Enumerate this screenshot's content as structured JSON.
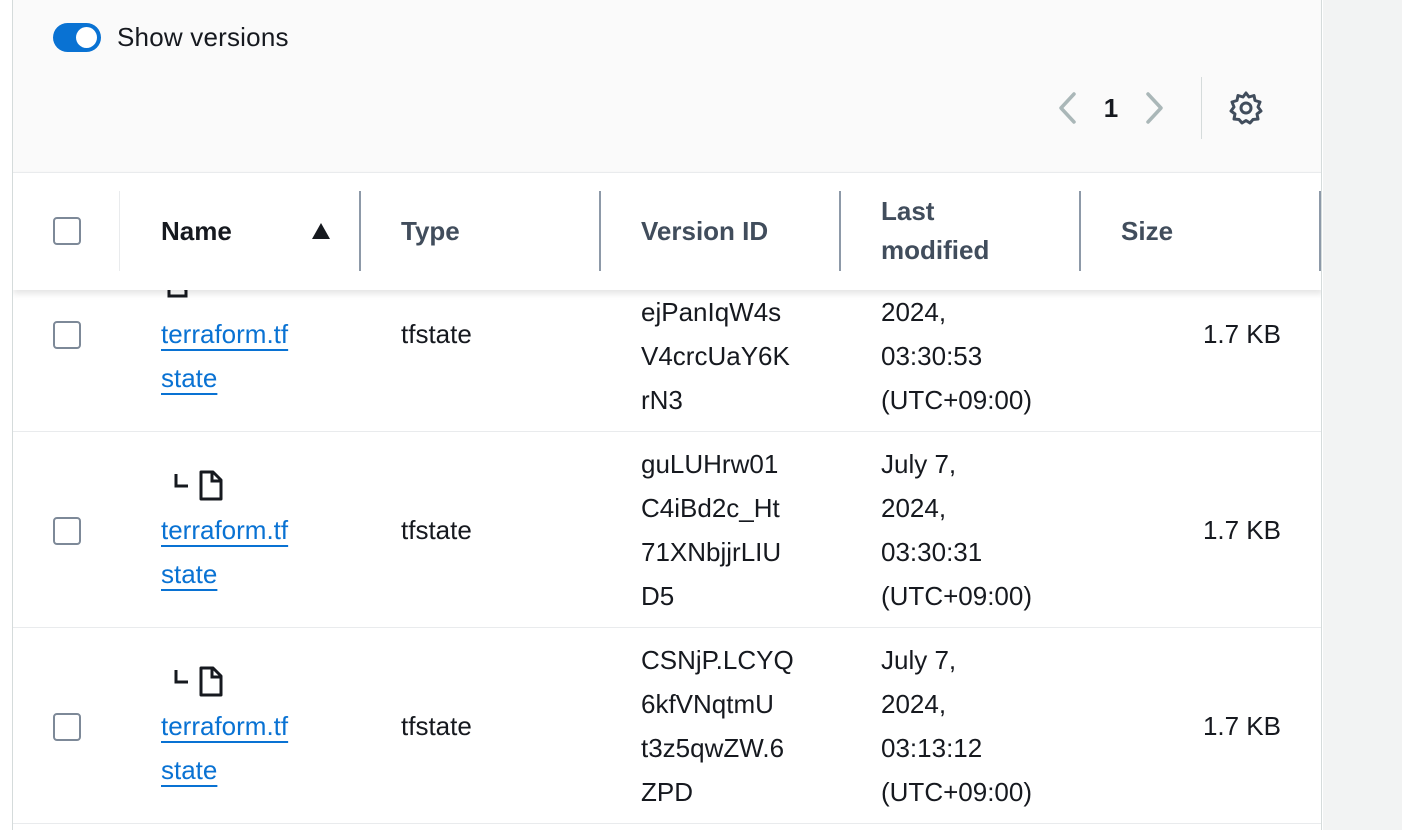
{
  "toggle": {
    "label": "Show versions",
    "on": true,
    "color": "#0972d3"
  },
  "pagination": {
    "current_page": "1"
  },
  "columns": {
    "name": "Name",
    "type": "Type",
    "version_id": "Version ID",
    "last_modified_1": "Last",
    "last_modified_2": "modified",
    "size": "Size"
  },
  "rows": [
    {
      "name_1": "terraform.tf",
      "name_2": "state",
      "type": "tfstate",
      "version_lines": [
        "ejPanIqW4s",
        "V4crcUaY6K",
        "rN3"
      ],
      "modified_lines": [
        "2024,",
        "03:30:53",
        "(UTC+09:00)"
      ],
      "size": "1.7 KB"
    },
    {
      "name_1": "terraform.tf",
      "name_2": "state",
      "type": "tfstate",
      "version_lines": [
        "guLUHrw01",
        "C4iBd2c_Ht",
        "71XNbjjrLIU",
        "D5"
      ],
      "modified_lines": [
        "July 7,",
        "2024,",
        "03:30:31",
        "(UTC+09:00)"
      ],
      "size": "1.7 KB"
    },
    {
      "name_1": "terraform.tf",
      "name_2": "state",
      "type": "tfstate",
      "version_lines": [
        "CSNjP.LCYQ",
        "6kfVNqtmU",
        "t3z5qwZW.6",
        "ZPD"
      ],
      "modified_lines": [
        "July 7,",
        "2024,",
        "03:13:12",
        "(UTC+09:00)"
      ],
      "size": "1.7 KB"
    }
  ],
  "colors": {
    "link": "#0972d3",
    "header_text": "#414d5c",
    "border": "#e9ebed"
  }
}
